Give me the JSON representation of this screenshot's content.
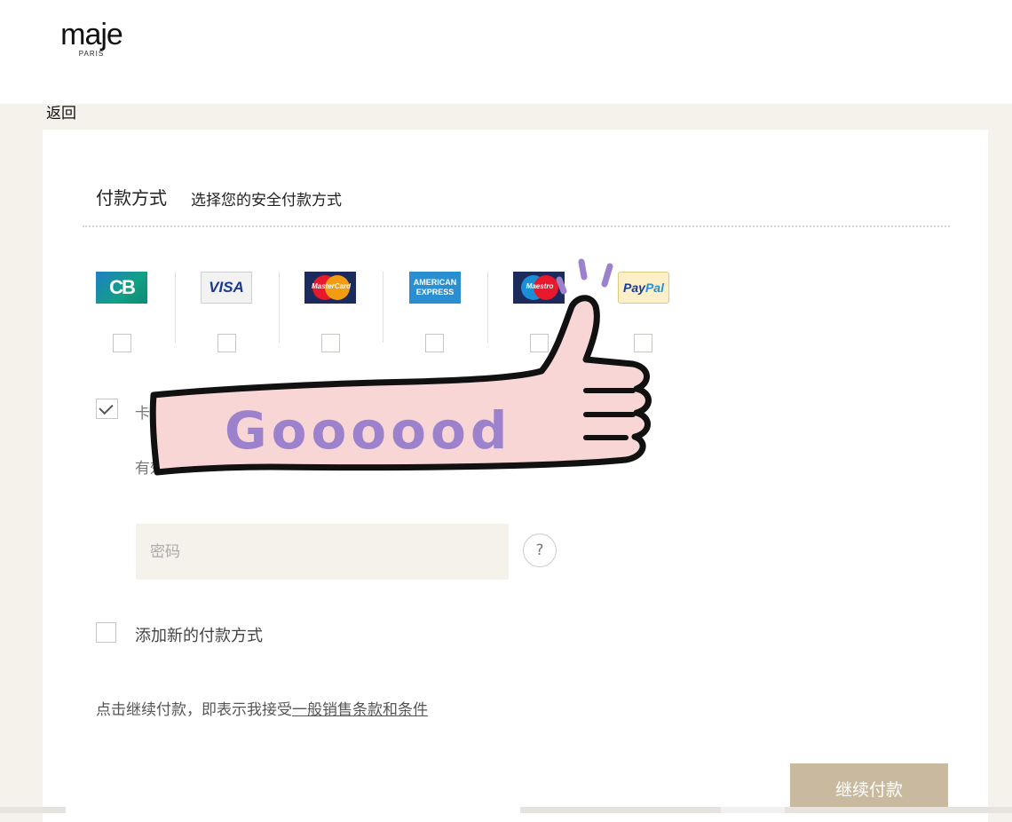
{
  "header": {
    "logo_text": "maje",
    "logo_subtext": "PARIS",
    "back_label": "返回"
  },
  "payment": {
    "title": "付款方式",
    "subtitle": "选择您的安全付款方式",
    "methods": [
      {
        "name": "CB",
        "icon": "cb-card-icon"
      },
      {
        "name": "VISA",
        "icon": "visa-card-icon"
      },
      {
        "name": "MasterCard",
        "icon": "mastercard-icon"
      },
      {
        "name": "AMERICAN EXPRESS",
        "icon": "amex-card-icon"
      },
      {
        "name": "Maestro",
        "icon": "maestro-card-icon"
      },
      {
        "name": "PayPal",
        "icon": "paypal-icon"
      }
    ],
    "saved_card_label": "卡",
    "expiry_label": "有效",
    "password_placeholder": "密码",
    "help_label": "?",
    "add_new_label": "添加新的付款方式",
    "terms_prefix": "点击继续付款，即表示我接受",
    "terms_link": "一般销售条款和条件",
    "continue_label": "继续付款"
  },
  "sticker": {
    "text": "Goooood",
    "icon": "thumbs-up-sticker-icon"
  },
  "colors": {
    "page_bg": "#f5f1eb",
    "button": "#c9b99e",
    "sticker_fill": "#f8d6d6",
    "sticker_text": "#9c82cc"
  }
}
